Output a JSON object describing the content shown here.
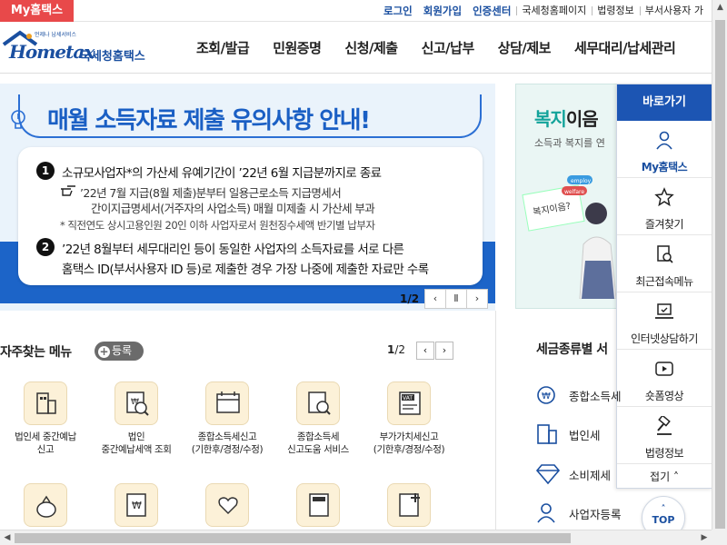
{
  "topbar": {
    "myhome_tab": "My홈택스",
    "links": [
      "로그인",
      "회원가입",
      "인증센터",
      "국세청홈페이지",
      "법령정보",
      "부서사용자 가"
    ]
  },
  "header": {
    "logo_small": "언제나 납세서비스",
    "logo_main": "Hometax",
    "logo_kor": "국세청홈택스",
    "nav": [
      "조회/발급",
      "민원증명",
      "신청/제출",
      "신고/납부",
      "상담/제보",
      "세무대리/납세관리"
    ]
  },
  "banner": {
    "title": "매월 소득자료 제출 유의사항 안내!",
    "items": [
      {
        "num": "1",
        "text": "소규모사업자*의 가산세 유예기간이 ’22년 6월 지급분까지로 종료",
        "sub1": "’22년 7월 지급(8월 제출)분부터 일용근로소득 지급명세서",
        "sub2": "간이지급명세서(거주자의 사업소득) 매월 미제출 시 가산세 부과",
        "note": "* 직전연도 상시고용인원 20인 이하 사업자로서 원천징수세액 반기별 납부자"
      },
      {
        "num": "2",
        "text": "’22년 8월부터 세무대리인 등이 동일한 사업자의 소득자료를 서로 다른",
        "text2": "홈택스 ID(부서사용자 ID 등)로 제출한 경우 가장 나중에 제출한 자료만 수록"
      }
    ],
    "page_current": "1",
    "page_total": "/2",
    "prev": "‹",
    "pause": "Ⅱ",
    "next": "›"
  },
  "welfare": {
    "title_em": "복지",
    "title_rest": "이음",
    "sub": "소득과 복지를 연",
    "sign_text": "복지이음?",
    "tag1": "",
    "tag2": "employ",
    "tag3": "welfare"
  },
  "quick_menu": {
    "title": "자주찾는 메뉴",
    "add_label": "등록",
    "page_current": "1",
    "page_total": "/2",
    "items": [
      {
        "label": "법인세 중간예납\n신고",
        "icon": "building-icon"
      },
      {
        "label": "법인\n중간예납세액 조회",
        "icon": "won-search-icon"
      },
      {
        "label": "종합소득세신고\n(기한후/경정/수정)",
        "icon": "calendar-icon"
      },
      {
        "label": "종합소득세\n신고도움 서비스",
        "icon": "doc-search-icon"
      },
      {
        "label": "부가가치세신고\n(기한후/경정/수정)",
        "icon": "vat-icon"
      },
      {
        "label": "",
        "icon": "money-bag-icon"
      },
      {
        "label": "",
        "icon": "won-doc-icon"
      },
      {
        "label": "",
        "icon": "heart-hand-icon"
      },
      {
        "label": "",
        "icon": "calculator-icon"
      },
      {
        "label": "",
        "icon": "doc-plus-icon"
      }
    ]
  },
  "tax_types": {
    "title": "세금종류별 서",
    "items": [
      "종합소득세",
      "법인세",
      "소비제세",
      "사업자등록"
    ]
  },
  "quick_links": {
    "title": "바로가기",
    "items": [
      "My홈택스",
      "즐겨찾기",
      "최근접속메뉴",
      "인터넷상담하기",
      "숏폼영상",
      "법령정보"
    ],
    "fold": "접기 ˄"
  },
  "top_button": "TOP",
  "colors": {
    "brand_blue": "#1c55b3",
    "accent_red": "#e8494a",
    "banner_bg": "#eaf3fb",
    "welfare_green": "#12a39a"
  }
}
